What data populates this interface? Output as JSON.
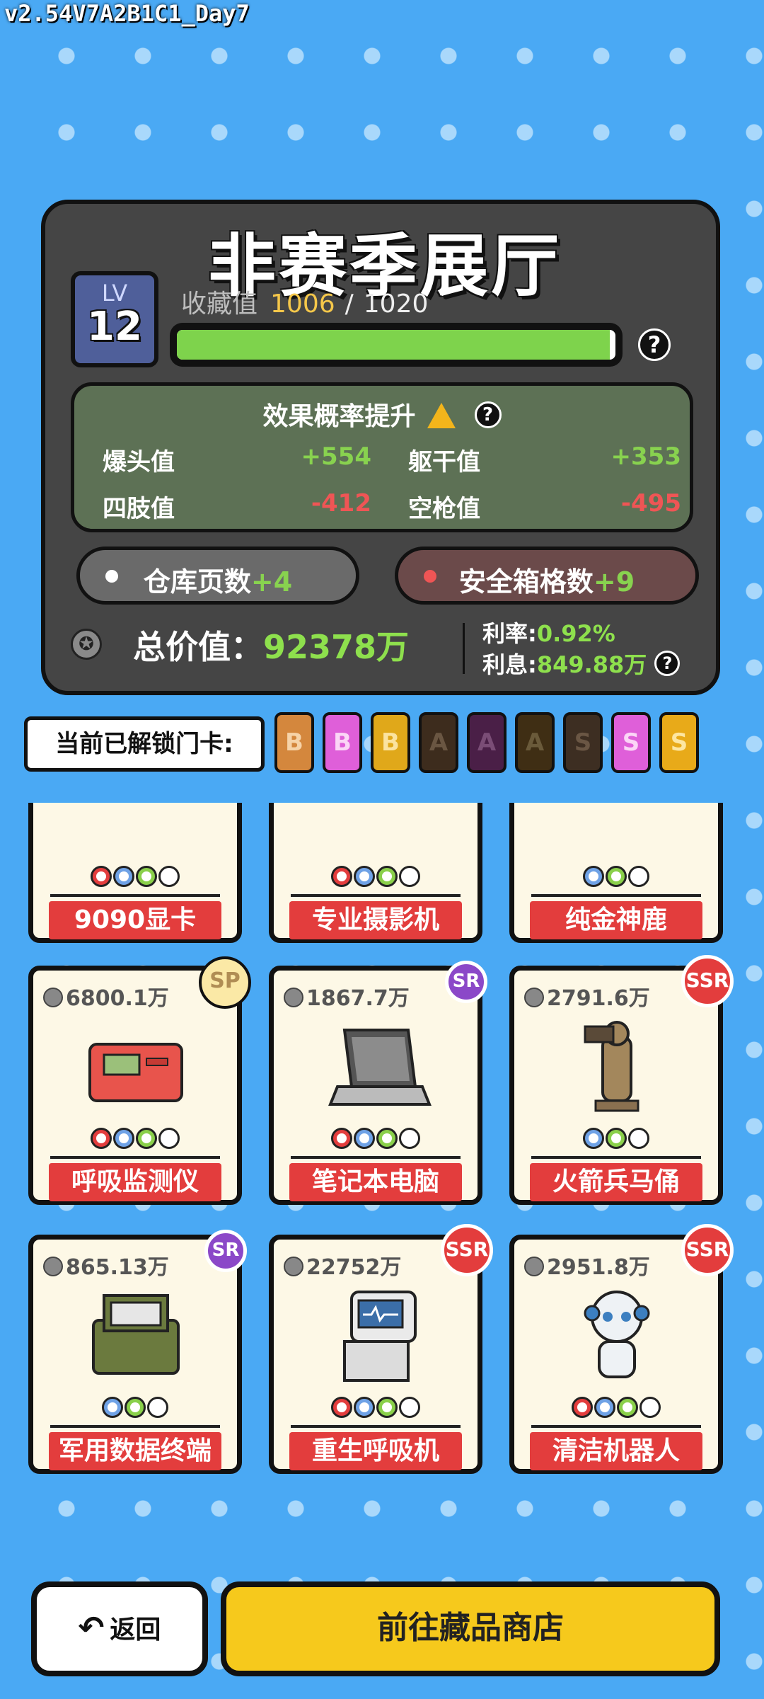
{
  "version": "v2.54V7A2B1C1_Day7",
  "hall": {
    "title": "非赛季展厅",
    "level_label": "LV",
    "level": "12",
    "collect_label": "收藏值",
    "collect_current": "1006",
    "collect_sep": "/",
    "collect_max": "1020",
    "progress_fraction": 0.9863
  },
  "effect": {
    "title": "效果概率提升",
    "stats": [
      {
        "label": "爆头值",
        "value": "+554",
        "sign": "pos"
      },
      {
        "label": "躯干值",
        "value": "+353",
        "sign": "pos"
      },
      {
        "label": "四肢值",
        "value": "-412",
        "sign": "neg"
      },
      {
        "label": "空枪值",
        "value": "-495",
        "sign": "neg"
      }
    ]
  },
  "buttons": {
    "warehouse_label": "仓库页数",
    "warehouse_bonus": "+4",
    "safebox_label": "安全箱格数",
    "safebox_bonus": "+9",
    "back": "返回",
    "shop": "前往藏品商店"
  },
  "summary": {
    "total_label": "总价值：",
    "total_value": "92378万",
    "rate_label": "利率:",
    "rate_value": "0.92%",
    "interest_label": "利息:",
    "interest_value": "849.88万"
  },
  "doors": {
    "label": "当前已解锁门卡:",
    "cards": [
      {
        "letter": "B",
        "bg": "#d4873d",
        "fg": "#f6d3a8"
      },
      {
        "letter": "B",
        "bg": "#df5fd9",
        "fg": "#fbd5f6"
      },
      {
        "letter": "B",
        "bg": "#e0a81a",
        "fg": "#fbe3a0"
      },
      {
        "letter": "A",
        "bg": "#3d2c1d",
        "fg": "#6a5642"
      },
      {
        "letter": "A",
        "bg": "#4a1f47",
        "fg": "#7a4d76"
      },
      {
        "letter": "A",
        "bg": "#3f2e14",
        "fg": "#6a5a3a"
      },
      {
        "letter": "S",
        "bg": "#3d2e22",
        "fg": "#6a5644"
      },
      {
        "letter": "S",
        "bg": "#df5fd9",
        "fg": "#fbd5f6"
      },
      {
        "letter": "S",
        "bg": "#e8aa19",
        "fg": "#fde6a2"
      }
    ]
  },
  "colors": {
    "accent_green": "#8ee04d",
    "negative_red": "#ef5555",
    "name_red": "#e33d3d",
    "shop_yellow": "#f6c91c",
    "bg_blue": "#4aa9f4"
  },
  "items": [
    {
      "name": "9090显卡",
      "price": "",
      "rarity": "",
      "slots": [
        "#e33d3d",
        "#6fa2e6",
        "#8ad04a",
        "#ffffff"
      ],
      "icon": "gpu-icon"
    },
    {
      "name": "专业摄影机",
      "price": "",
      "rarity": "",
      "slots": [
        "#e33d3d",
        "#6fa2e6",
        "#8ad04a",
        "#ffffff"
      ],
      "icon": "camera-icon"
    },
    {
      "name": "纯金神鹿",
      "price": "",
      "rarity": "",
      "slots": [
        "#6fa2e6",
        "#8ad04a",
        "#ffffff"
      ],
      "icon": "deer-icon"
    },
    {
      "name": "呼吸监测仪",
      "price": "6800.1万",
      "rarity": "SP",
      "slots": [
        "#e33d3d",
        "#6fa2e6",
        "#8ad04a",
        "#ffffff"
      ],
      "icon": "monitor-icon"
    },
    {
      "name": "笔记本电脑",
      "price": "1867.7万",
      "rarity": "SR",
      "slots": [
        "#e33d3d",
        "#6fa2e6",
        "#8ad04a",
        "#ffffff"
      ],
      "icon": "laptop-icon"
    },
    {
      "name": "火箭兵马俑",
      "price": "2791.6万",
      "rarity": "SSR",
      "slots": [
        "#6fa2e6",
        "#8ad04a",
        "#ffffff"
      ],
      "icon": "terracotta-icon"
    },
    {
      "name": "军用数据终端",
      "price": "865.13万",
      "rarity": "SR",
      "slots": [
        "#6fa2e6",
        "#8ad04a",
        "#ffffff"
      ],
      "icon": "terminal-icon"
    },
    {
      "name": "重生呼吸机",
      "price": "22752万",
      "rarity": "SSR",
      "slots": [
        "#e33d3d",
        "#6fa2e6",
        "#8ad04a",
        "#ffffff"
      ],
      "icon": "ventilator-icon"
    },
    {
      "name": "清洁机器人",
      "price": "2951.8万",
      "rarity": "SSR",
      "slots": [
        "#e33d3d",
        "#6fa2e6",
        "#8ad04a",
        "#ffffff"
      ],
      "icon": "robot-icon"
    }
  ]
}
